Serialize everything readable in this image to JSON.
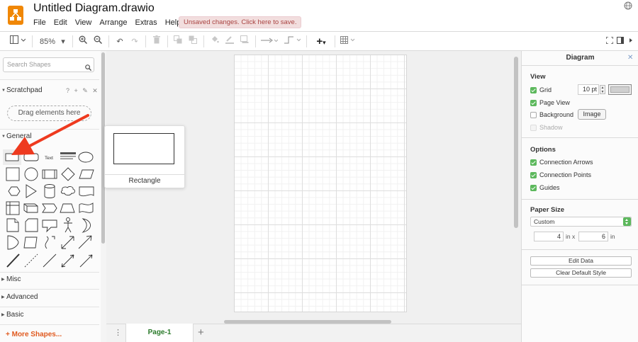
{
  "app": {
    "title": "Untitled Diagram.drawio",
    "menu": [
      "File",
      "Edit",
      "View",
      "Arrange",
      "Extras",
      "Help"
    ],
    "unsaved_notice": "Unsaved changes. Click here to save."
  },
  "toolbar": {
    "zoom": "85%"
  },
  "sidebar": {
    "search_placeholder": "Search Shapes",
    "scratchpad_title": "Scratchpad",
    "scratchpad_tools": "? + ✎ ✕",
    "drag_hint": "Drag elements here",
    "general_title": "General",
    "text_shape_label": "Text",
    "collapsed_sections": [
      "Misc",
      "Advanced",
      "Basic"
    ],
    "more_shapes": "+ More Shapes..."
  },
  "tooltip": {
    "label": "Rectangle"
  },
  "pages": {
    "active_tab": "Page-1"
  },
  "panel": {
    "title": "Diagram",
    "view": {
      "heading": "View",
      "grid_label": "Grid",
      "grid_enabled": true,
      "grid_size": "10 pt",
      "page_view_label": "Page View",
      "page_view_enabled": true,
      "background_label": "Background",
      "background_enabled": false,
      "image_button": "Image",
      "shadow_label": "Shadow",
      "shadow_enabled": false
    },
    "options": {
      "heading": "Options",
      "connection_arrows": "Connection Arrows",
      "connection_points": "Connection Points",
      "guides": "Guides"
    },
    "paper": {
      "heading": "Paper Size",
      "selected": "Custom",
      "width": "4",
      "width_unit": "in x",
      "height": "6",
      "height_unit": "in"
    },
    "edit_data": "Edit Data",
    "clear_default_style": "Clear Default Style"
  },
  "colors": {
    "logo": "#f08705",
    "checkbox_on": "#5cb85c",
    "annotation_arrow": "#ee3a1f",
    "active_tab_text": "#2a7a2a",
    "more_shapes": "#e05a1f"
  }
}
